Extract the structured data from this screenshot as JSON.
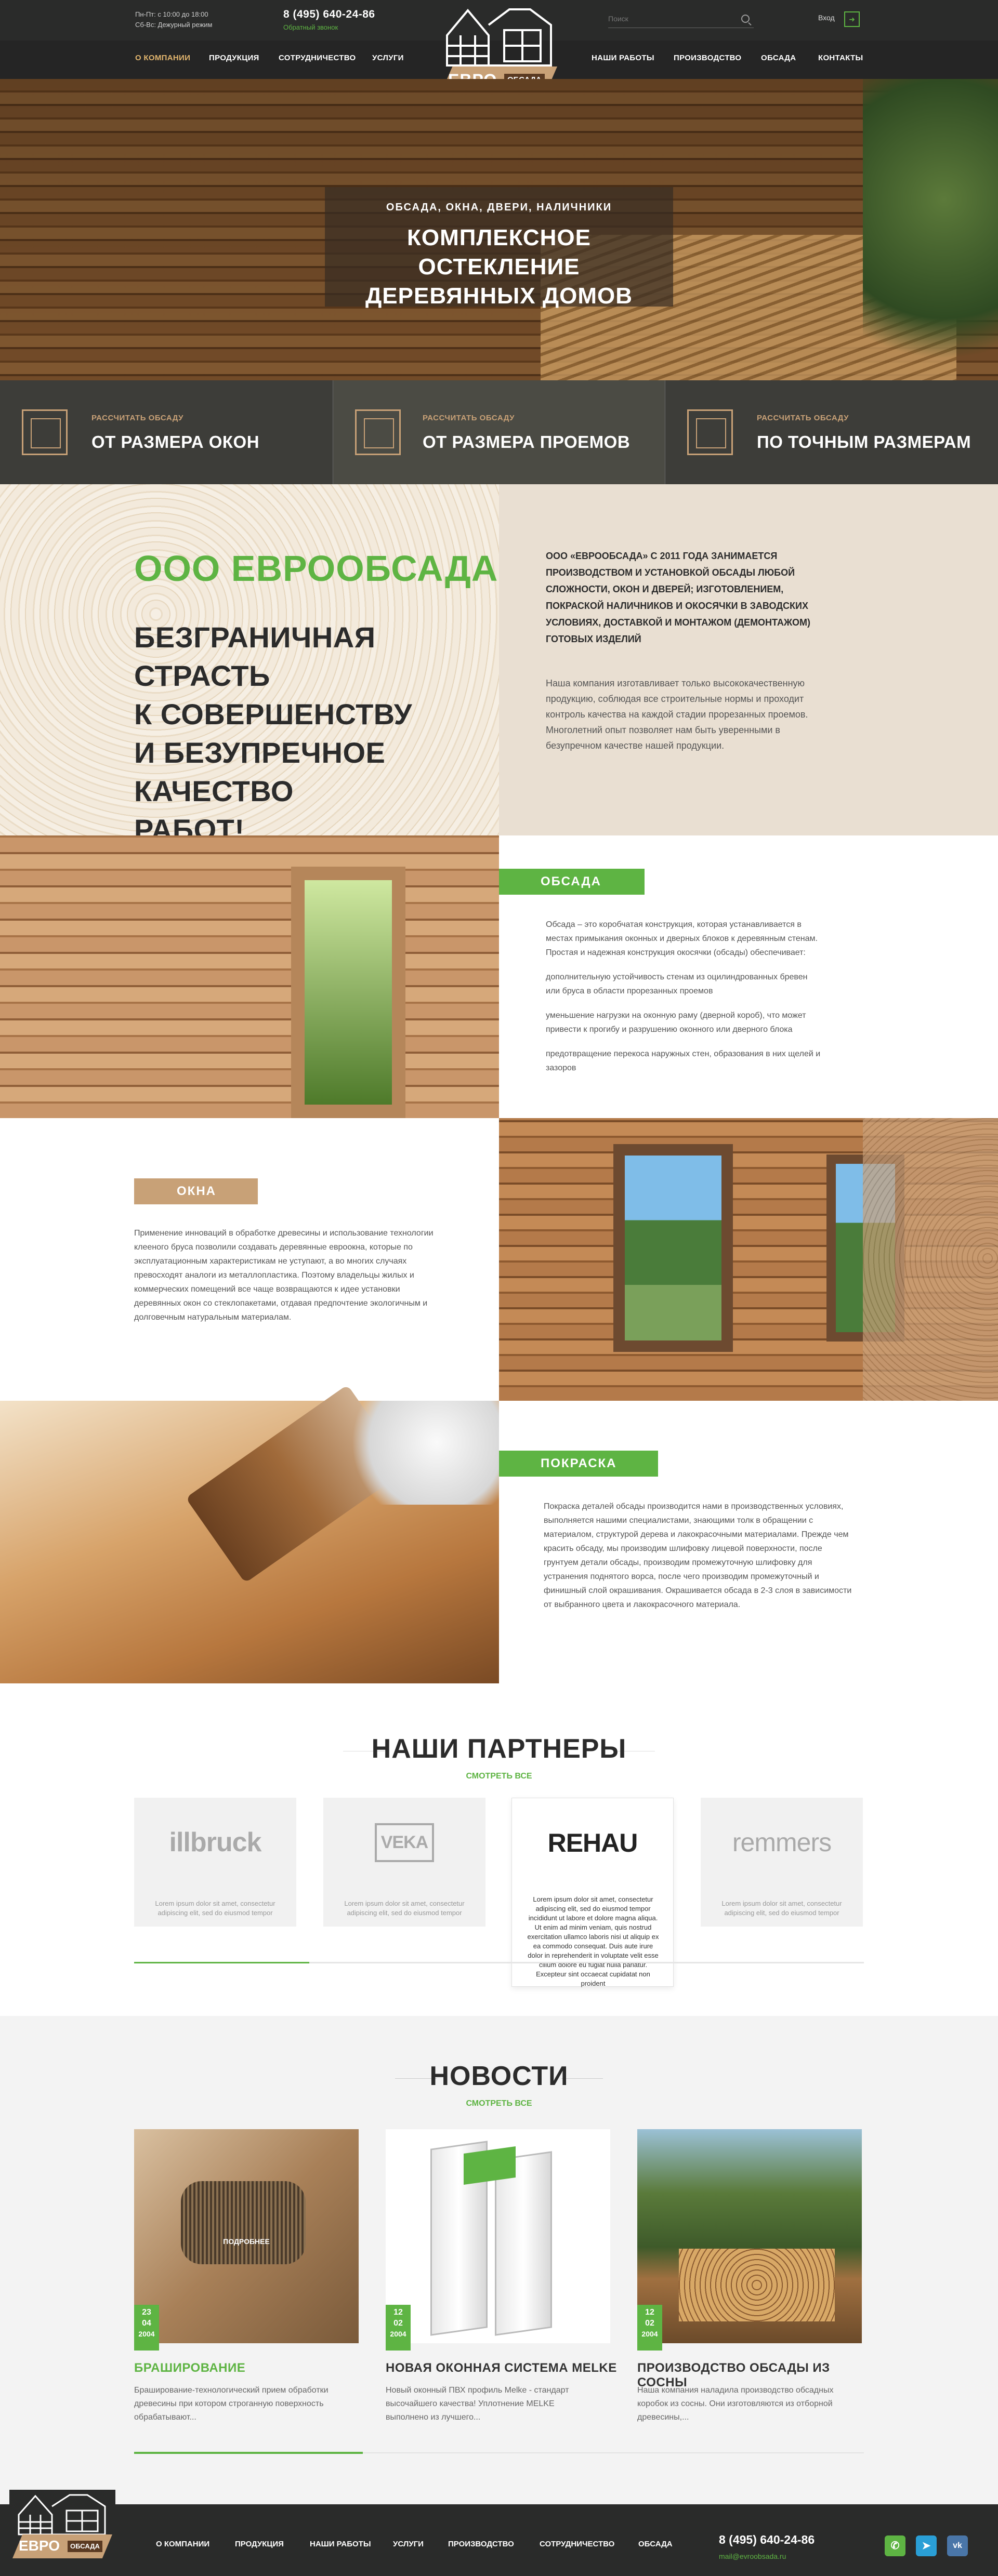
{
  "header": {
    "hours": [
      "Пн-Пт: с 10:00 до 18:00",
      "Сб-Вс: Дежурный режим"
    ],
    "phone": "8 (495) 640-24-86",
    "callback": "Обратный звонок",
    "search_placeholder": "Поиск",
    "login": "Вход",
    "logo": {
      "evro": "ЕВРО",
      "obsada": "ОБСАДА"
    },
    "nav_left": [
      "О КОМПАНИИ",
      "ПРОДУКЦИЯ",
      "СОТРУДНИЧЕСТВО",
      "УСЛУГИ"
    ],
    "nav_right": [
      "НАШИ РАБОТЫ",
      "ПРОИЗВОДСТВО",
      "ОБСАДА",
      "КОНТАКТЫ"
    ],
    "active_nav": "О КОМПАНИИ"
  },
  "hero": {
    "subtitle": "ОБСАДА, ОКНА, ДВЕРИ, НАЛИЧНИКИ",
    "title_line1": "КОМПЛЕКСНОЕ ОСТЕКЛЕНИЕ",
    "title_line2": "ДЕРЕВЯННЫХ ДОМОВ"
  },
  "calc": [
    {
      "label": "РАССЧИТАТЬ ОБСАДУ",
      "title": "ОТ РАЗМЕРА ОКОН"
    },
    {
      "label": "РАССЧИТАТЬ ОБСАДУ",
      "title": "ОТ РАЗМЕРА ПРОЕМОВ"
    },
    {
      "label": "РАССЧИТАТЬ ОБСАДУ",
      "title": "ПО ТОЧНЫМ РАЗМЕРАМ"
    }
  ],
  "about": {
    "title": "ООО ЕВРООБСАДА",
    "slogan_lines": [
      "БЕЗГРАНИЧНАЯ СТРАСТЬ",
      "К СОВЕРШЕНСТВУ",
      "И БЕЗУПРЕЧНОЕ КАЧЕСТВО",
      "РАБОТ!"
    ],
    "lead": "ООО «ЕВРООБСАДА» С 2011 ГОДА ЗАНИМАЕТСЯ ПРОИЗВОДСТВОМ И УСТАНОВКОЙ ОБСАДЫ ЛЮБОЙ СЛОЖНОСТИ, ОКОН И ДВЕРЕЙ; ИЗГОТОВЛЕНИЕМ, ПОКРАСКОЙ НАЛИЧНИКОВ И ОКОСЯЧКИ В ЗАВОДСКИХ УСЛОВИЯХ, ДОСТАВКОЙ И МОНТАЖОМ (ДЕМОНТАЖОМ) ГОТОВЫХ ИЗДЕЛИЙ",
    "text": "Наша компания изготавливает только высококачественную продукцию, соблюдая все строительные нормы и проходит контроль качества на каждой стадии прорезанных проемов. Многолетний опыт позволяет нам быть уверенными в безупречном качестве нашей продукции."
  },
  "features": {
    "obsada": {
      "tag": "ОБСАДА",
      "paragraphs": [
        "Обсада – это коробчатая конструкция, которая устанавливается в местах примыкания оконных и дверных блоков к деревянным стенам. Простая и надежная конструкция окосячки (обсады) обеспечивает:",
        "дополнительную устойчивость стенам из оцилиндрованных бревен или бруса в области прорезанных проемов",
        "уменьшение нагрузки на оконную раму (дверной короб), что может привести к прогибу и разрушению оконного или дверного блока",
        "предотвращение перекоса наружных стен, образования в них щелей и зазоров"
      ]
    },
    "okna": {
      "tag": "ОКНА",
      "text": "Применение инноваций в обработке древесины и использование технологии клееного бруса позволили создавать деревянные евроокна, которые по эксплуатационным характеристикам не уступают, а во многих случаях превосходят аналоги из металлопластика. Поэтому владельцы жилых и коммерческих помещений все чаще возвращаются к идее установки деревянных окон со стеклопакетами, отдавая предпочтение экологичным и долговечным натуральным материалам."
    },
    "pokraska": {
      "tag": "ПОКРАСКА",
      "text": "Покраска деталей обсады производится нами в производственных условиях, выполняется нашими специалистами, знающими толк в обращении с материалом, структурой дерева и лакокрасочными материалами. Прежде чем красить обсаду, мы производим шлифовку лицевой поверхности, после грунтуем детали обсады, производим промежуточную шлифовку для устранения поднятого ворса, после чего производим промежуточный и финишный слой окрашивания. Окрашивается обсада в 2-3 слоя в зависимости от выбранного цвета и лакокрасочного материала."
    }
  },
  "partners": {
    "title": "НАШИ ПАРТНЕРЫ",
    "link": "СМОТРЕТЬ ВСЕ",
    "items": [
      {
        "name": "illbruck",
        "desc": "Lorem ipsum dolor sit amet, consectetur adipiscing elit, sed do eiusmod tempor"
      },
      {
        "name": "VEKA",
        "desc": "Lorem ipsum dolor sit amet, consectetur adipiscing elit, sed do eiusmod tempor"
      },
      {
        "name": "REHAU",
        "desc": "Lorem ipsum dolor sit amet, consectetur adipiscing elit, sed do eiusmod tempor incididunt ut labore et dolore magna aliqua. Ut enim ad minim veniam, quis nostrud exercitation ullamco laboris nisi ut aliquip ex ea commodo consequat. Duis aute irure dolor in reprehenderit in voluptate velit esse cillum dolore eu fugiat nulla pariatur. Excepteur sint occaecat cupidatat non proident"
      },
      {
        "name": "remmers",
        "desc": "Lorem ipsum dolor sit amet, consectetur adipiscing elit, sed do eiusmod tempor"
      }
    ],
    "progress": 0.24
  },
  "news": {
    "title": "НОВОСТИ",
    "link": "СМОТРЕТЬ ВСЕ",
    "more": "ПОДРОБНЕЕ",
    "items": [
      {
        "day": "23",
        "month": "04",
        "year": "2004",
        "title": "БРАШИРОВАНИЕ",
        "text": "Браширование-технологический прием обработки древесины при котором строганную поверхность обрабатывают..."
      },
      {
        "day": "12",
        "month": "02",
        "year": "2004",
        "title": "НОВАЯ ОКОННАЯ СИСТЕМА MELKE",
        "text": "Новый оконный ПВХ профиль Melke - стандарт высочайшего качества! Уплотнение MELKE выполнено из лучшего..."
      },
      {
        "day": "12",
        "month": "02",
        "year": "2004",
        "title": "ПРОИЗВОДСТВО ОБСАДЫ ИЗ СОСНЫ",
        "text": "Наша компания наладила производство обсадных коробок из сосны. Они изготовляются из отборной древесины,..."
      }
    ]
  },
  "footer": {
    "nav": [
      "О КОМПАНИИ",
      "ПРОДУКЦИЯ",
      "НАШИ РАБОТЫ",
      "УСЛУГИ",
      "ПРОИЗВОДСТВО",
      "СОТРУДНИЧЕСТВО",
      "ОБСАДА"
    ],
    "phone": "8 (495) 640-24-86",
    "email": "mail@evroobsada.ru",
    "socials": [
      "whatsapp-icon",
      "telegram-icon",
      "vk-icon"
    ]
  },
  "colors": {
    "accent_green": "#5eb443",
    "accent_tan": "#c8a177",
    "dark": "#2a2b2a"
  }
}
